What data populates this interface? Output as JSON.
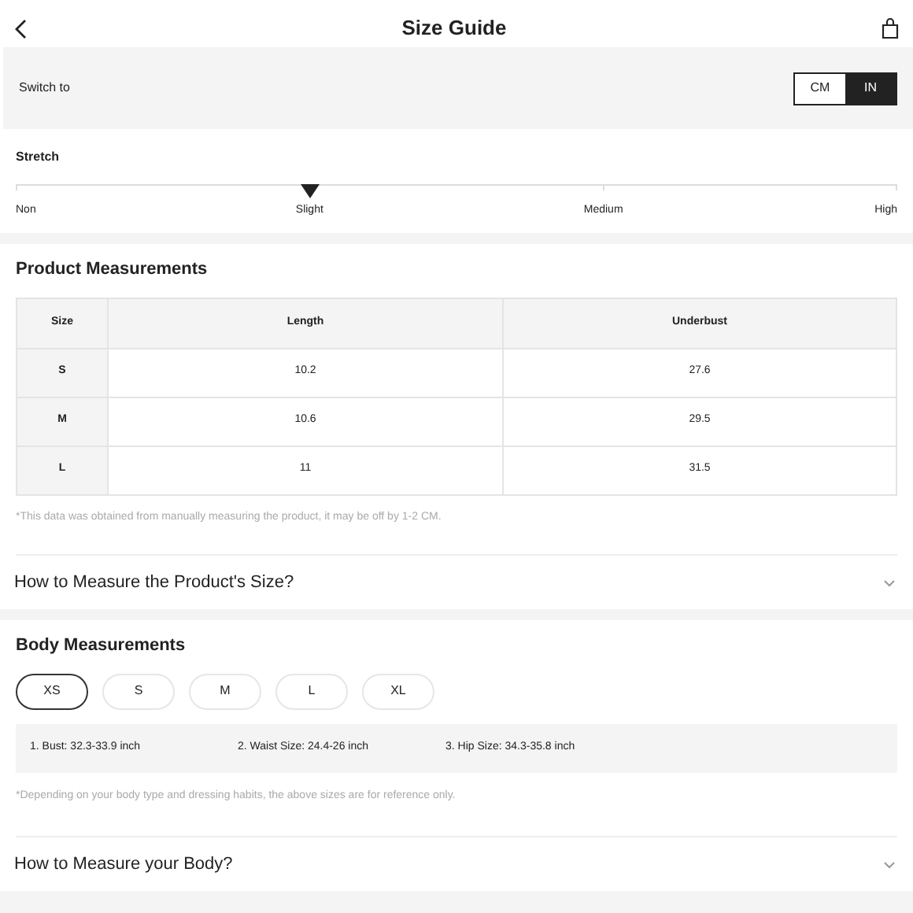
{
  "header": {
    "title": "Size Guide"
  },
  "unit_switch": {
    "label": "Switch to",
    "options": [
      {
        "label": "CM",
        "selected": false
      },
      {
        "label": "IN",
        "selected": true
      }
    ]
  },
  "stretch": {
    "title": "Stretch",
    "options": [
      {
        "label": "Non",
        "selected": false
      },
      {
        "label": "Slight",
        "selected": true
      },
      {
        "label": "Medium",
        "selected": false
      },
      {
        "label": "High",
        "selected": false
      }
    ]
  },
  "product_measurements": {
    "title": "Product Measurements",
    "columns": [
      "Size",
      "Length",
      "Underbust"
    ],
    "rows": [
      [
        "S",
        "10.2",
        "27.6"
      ],
      [
        "M",
        "10.6",
        "29.5"
      ],
      [
        "L",
        "11",
        "31.5"
      ]
    ],
    "note": "*This data was obtained from manually measuring the product, it may be off by 1-2 CM."
  },
  "product_accordion": {
    "title": "How to Measure the Product's Size?",
    "expanded": false
  },
  "body_measurements": {
    "title": "Body Measurements",
    "sizes": [
      {
        "label": "XS",
        "selected": true
      },
      {
        "label": "S",
        "selected": false
      },
      {
        "label": "M",
        "selected": false
      },
      {
        "label": "L",
        "selected": false
      },
      {
        "label": "XL",
        "selected": false
      }
    ],
    "details": [
      "1. Bust: 32.3-33.9 inch",
      "2. Waist Size: 24.4-26 inch",
      "3. Hip Size: 34.3-35.8 inch"
    ],
    "note": "*Depending on your body type and dressing habits, the above sizes are for reference only."
  },
  "body_accordion": {
    "title": "How to Measure your Body?",
    "expanded": false
  }
}
